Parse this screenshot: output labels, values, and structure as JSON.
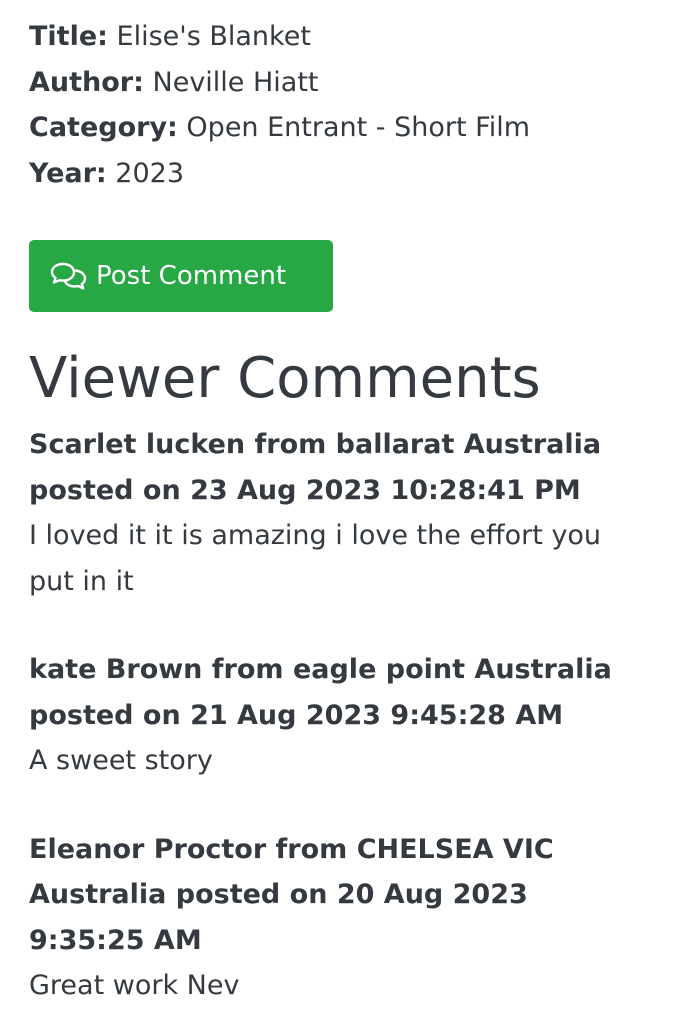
{
  "details": {
    "title_label": "Title:",
    "title_value": " Elise's Blanket",
    "author_label": "Author:",
    "author_value": " Neville Hiatt",
    "category_label": "Category:",
    "category_value": " Open Entrant - Short Film",
    "year_label": "Year:",
    "year_value": " 2023"
  },
  "post_button": {
    "label": "Post Comment",
    "icon": "comments-icon",
    "color": "#28a745"
  },
  "comments_heading": "Viewer Comments",
  "comments": [
    {
      "header": "Scarlet lucken from ballarat Australia posted on 23 Aug 2023 10:28:41 PM",
      "text": "I loved it it is amazing i love the effort you put in it"
    },
    {
      "header": "kate Brown from eagle point Australia posted on 21 Aug 2023 9:45:28 AM",
      "text": "A sweet story"
    },
    {
      "header": "Eleanor Proctor from CHELSEA VIC Australia posted on 20 Aug 2023 9:35:25 AM",
      "text": "Great work Nev"
    }
  ]
}
